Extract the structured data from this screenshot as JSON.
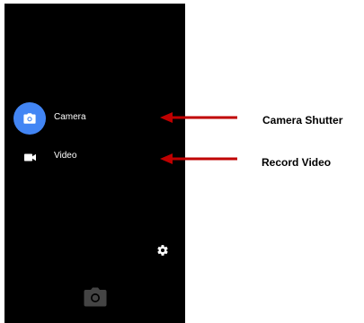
{
  "colors": {
    "screen_bg": "#000000",
    "accent": "#4285f4",
    "icon_white": "#ffffff",
    "shutter_icon": "#444444",
    "arrow": "#c00000"
  },
  "camera_app": {
    "modes": [
      {
        "label": "Camera",
        "icon": "camera-icon",
        "selected": true
      },
      {
        "label": "Video",
        "icon": "videocam-icon",
        "selected": false
      }
    ],
    "settings_icon": "gear-icon",
    "shutter_icon": "camera-icon"
  },
  "annotations": {
    "shutter": "Camera Shutter",
    "video": "Record Video"
  }
}
